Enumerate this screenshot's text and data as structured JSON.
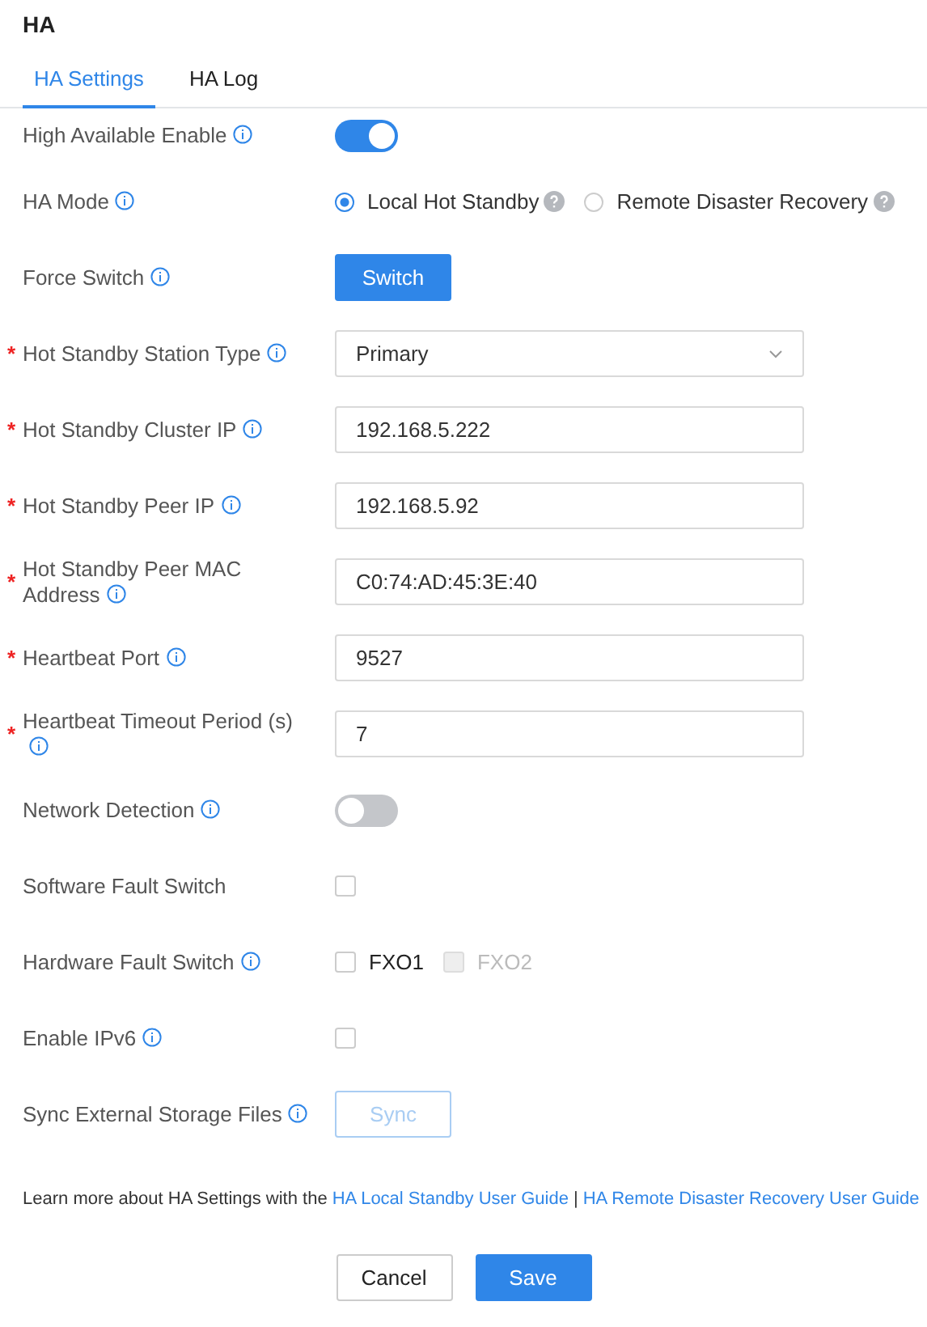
{
  "title": "HA",
  "tabs": [
    {
      "label": "HA Settings",
      "selected": true
    },
    {
      "label": "HA Log",
      "selected": false
    }
  ],
  "fields": [
    {
      "label": "High Available Enable",
      "info": true,
      "kind": "toggle",
      "on": true
    },
    {
      "label": "HA Mode",
      "info": true,
      "kind": "radio",
      "options": [
        {
          "label": "Local Hot Standby",
          "selected": true,
          "help": true
        },
        {
          "label": "Remote Disaster Recovery",
          "selected": false,
          "help": true
        }
      ]
    },
    {
      "label": "Force Switch",
      "info": true,
      "kind": "button",
      "button": "Switch",
      "disabled": false
    },
    {
      "label": "Hot Standby Station Type",
      "info": true,
      "marker": "*",
      "kind": "select",
      "value": "Primary"
    },
    {
      "label": "Hot Standby Cluster IP",
      "info": true,
      "marker": "*",
      "kind": "input",
      "value": "192.168.5.222"
    },
    {
      "label": "Hot Standby Peer IP",
      "info": true,
      "marker": "*",
      "kind": "input",
      "value": "192.168.5.92"
    },
    {
      "label": "Hot Standby Peer MAC Address",
      "info": true,
      "marker": "*",
      "kind": "input",
      "value": "C0:74:AD:45:3E:40"
    },
    {
      "label": "Heartbeat Port",
      "info": true,
      "marker": "*",
      "kind": "input",
      "value": "9527"
    },
    {
      "label": "Heartbeat Timeout Period (s)",
      "info": true,
      "marker": "*",
      "kind": "input",
      "value": "7"
    },
    {
      "label": "Network Detection",
      "info": true,
      "kind": "toggle",
      "on": false
    },
    {
      "label": "Software Fault Switch",
      "info": false,
      "kind": "checkbox",
      "checked": false
    },
    {
      "label": "Hardware Fault Switch",
      "info": true,
      "kind": "checkboxes",
      "options": [
        {
          "label": "FXO1",
          "checked": false,
          "disabled": false
        },
        {
          "label": "FXO2",
          "checked": false,
          "disabled": true
        }
      ]
    },
    {
      "label": "Enable IPv6",
      "info": true,
      "kind": "checkbox",
      "checked": false
    },
    {
      "label": "Sync External Storage Files",
      "info": true,
      "kind": "button",
      "button": "Sync",
      "disabled": true
    }
  ],
  "note": {
    "text": "Learn more about HA Settings with the",
    "links": [
      "HA Local Standby User Guide",
      "HA Remote Disaster Recovery User Guide"
    ],
    "separator": "|"
  },
  "buttons": [
    {
      "label": "Cancel",
      "kind": "secondary"
    },
    {
      "label": "Save",
      "kind": "primary"
    }
  ]
}
